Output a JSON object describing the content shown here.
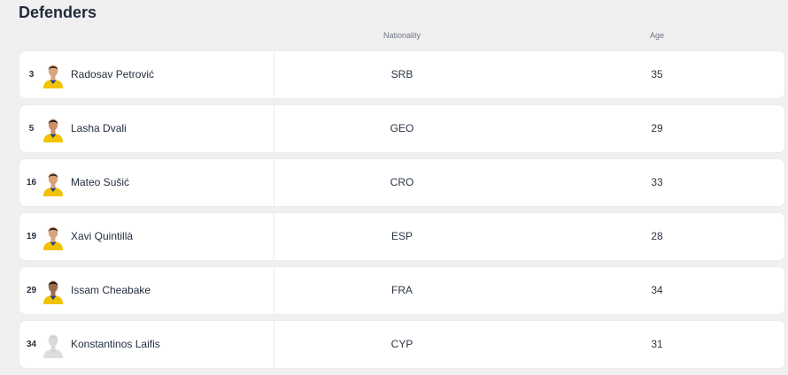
{
  "section": {
    "title": "Defenders"
  },
  "headers": {
    "nationality": "Nationality",
    "age": "Age"
  },
  "players": [
    {
      "number": "3",
      "name": "Radosav Petrović",
      "nationality": "SRB",
      "age": "35",
      "avatar": "player-photo",
      "skin": "#d9a77f",
      "hair": "#3a2a1e"
    },
    {
      "number": "5",
      "name": "Lasha Dvali",
      "nationality": "GEO",
      "age": "29",
      "avatar": "player-photo",
      "skin": "#c9906a",
      "hair": "#2b1d14"
    },
    {
      "number": "16",
      "name": "Mateo Sušić",
      "nationality": "CRO",
      "age": "33",
      "avatar": "player-photo",
      "skin": "#d6a27a",
      "hair": "#3b2c22"
    },
    {
      "number": "19",
      "name": "Xavi Quintillà",
      "nationality": "ESP",
      "age": "28",
      "avatar": "player-photo",
      "skin": "#d7a47c",
      "hair": "#2a1d15"
    },
    {
      "number": "29",
      "name": "Issam Cheabake",
      "nationality": "FRA",
      "age": "34",
      "avatar": "player-photo",
      "skin": "#9c6b4c",
      "hair": "#1d1410"
    },
    {
      "number": "34",
      "name": "Konstantinos Laifis",
      "nationality": "CYP",
      "age": "31",
      "avatar": "placeholder-silhouette",
      "skin": "#d9d9dc",
      "hair": "#cfcfd3"
    }
  ],
  "colors": {
    "kit_yellow": "#f2c200",
    "kit_blue": "#1c3f8f",
    "card": "#ffffff",
    "page": "#f0f0f1"
  }
}
